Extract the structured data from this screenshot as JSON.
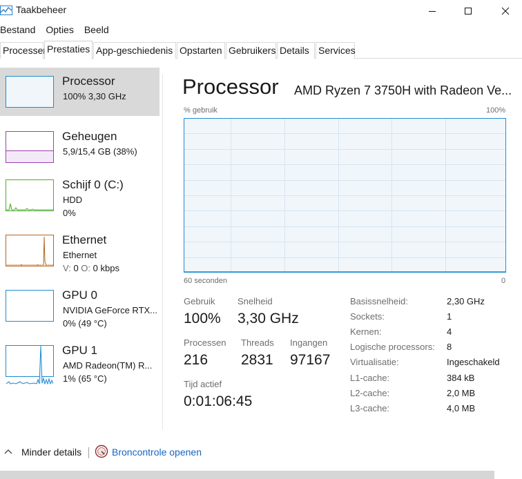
{
  "window": {
    "title": "Taakbeheer"
  },
  "menu": [
    "Bestand",
    "Opties",
    "Beeld"
  ],
  "tabs": [
    "Processen",
    "Prestaties",
    "App-geschiedenis",
    "Opstarten",
    "Gebruikers",
    "Details",
    "Services"
  ],
  "active_tab": "Prestaties",
  "sidebar": [
    {
      "name": "Processor",
      "line1": "100% 3,30 GHz",
      "line2": "",
      "color": "#1f8ad2",
      "selected": true
    },
    {
      "name": "Geheugen",
      "line1": "5,9/15,4 GB (38%)",
      "line2": "",
      "color": "#9a3fb5",
      "fill": 0.38
    },
    {
      "name": "Schijf 0 (C:)",
      "line1": "HDD",
      "line2": "0%",
      "color": "#4dab2b"
    },
    {
      "name": "Ethernet",
      "line1": "Ethernet",
      "line2_prefix_s": "V:",
      "line2_val_s": "0",
      "line2_prefix_r": "O:",
      "line2_val_r": "0 kbps",
      "color": "#b3641e"
    },
    {
      "name": "GPU 0",
      "line1": "NVIDIA GeForce RTX...",
      "line2": "0% (49 °C)",
      "color": "#1f8ad2"
    },
    {
      "name": "GPU 1",
      "line1": "AMD Radeon(TM) R...",
      "line2": "1% (65 °C)",
      "color": "#1f8ad2"
    }
  ],
  "main": {
    "title": "Processor",
    "subtitle": "AMD Ryzen 7 3750H with Radeon Ve...",
    "graph": {
      "y_label": "% gebruik",
      "y_max_label": "100%",
      "x_label": "60 seconden",
      "x_min_label": "0",
      "usage_percent": 0
    },
    "stats": {
      "gebruik_label": "Gebruik",
      "gebruik": "100%",
      "snelheid_label": "Snelheid",
      "snelheid": "3,30 GHz",
      "processen_label": "Processen",
      "processen": "216",
      "threads_label": "Threads",
      "threads": "2831",
      "ingangen_label": "Ingangen",
      "ingangen": "97167",
      "tijd_label": "Tijd actief",
      "tijd": "0:01:06:45"
    },
    "specs": [
      {
        "key": "Basissnelheid:",
        "value": "2,30 GHz"
      },
      {
        "key": "Sockets:",
        "value": "1"
      },
      {
        "key": "Kernen:",
        "value": "4"
      },
      {
        "key": "Logische processors:",
        "value": "8"
      },
      {
        "key": "Virtualisatie:",
        "value": "Ingeschakeld"
      },
      {
        "key": "L1-cache:",
        "value": "384 kB"
      },
      {
        "key": "L2-cache:",
        "value": "2,0 MB"
      },
      {
        "key": "L3-cache:",
        "value": "4,0 MB"
      }
    ]
  },
  "footer": {
    "less_details": "Minder details",
    "resource_monitor": "Broncontrole openen"
  },
  "colors": {
    "accent": "#1f8ad2",
    "link": "#1565c0",
    "selected_bg": "#d9d9d9",
    "graph_fill": "#f1f6fb",
    "graph_grid": "#d6e4f0"
  }
}
